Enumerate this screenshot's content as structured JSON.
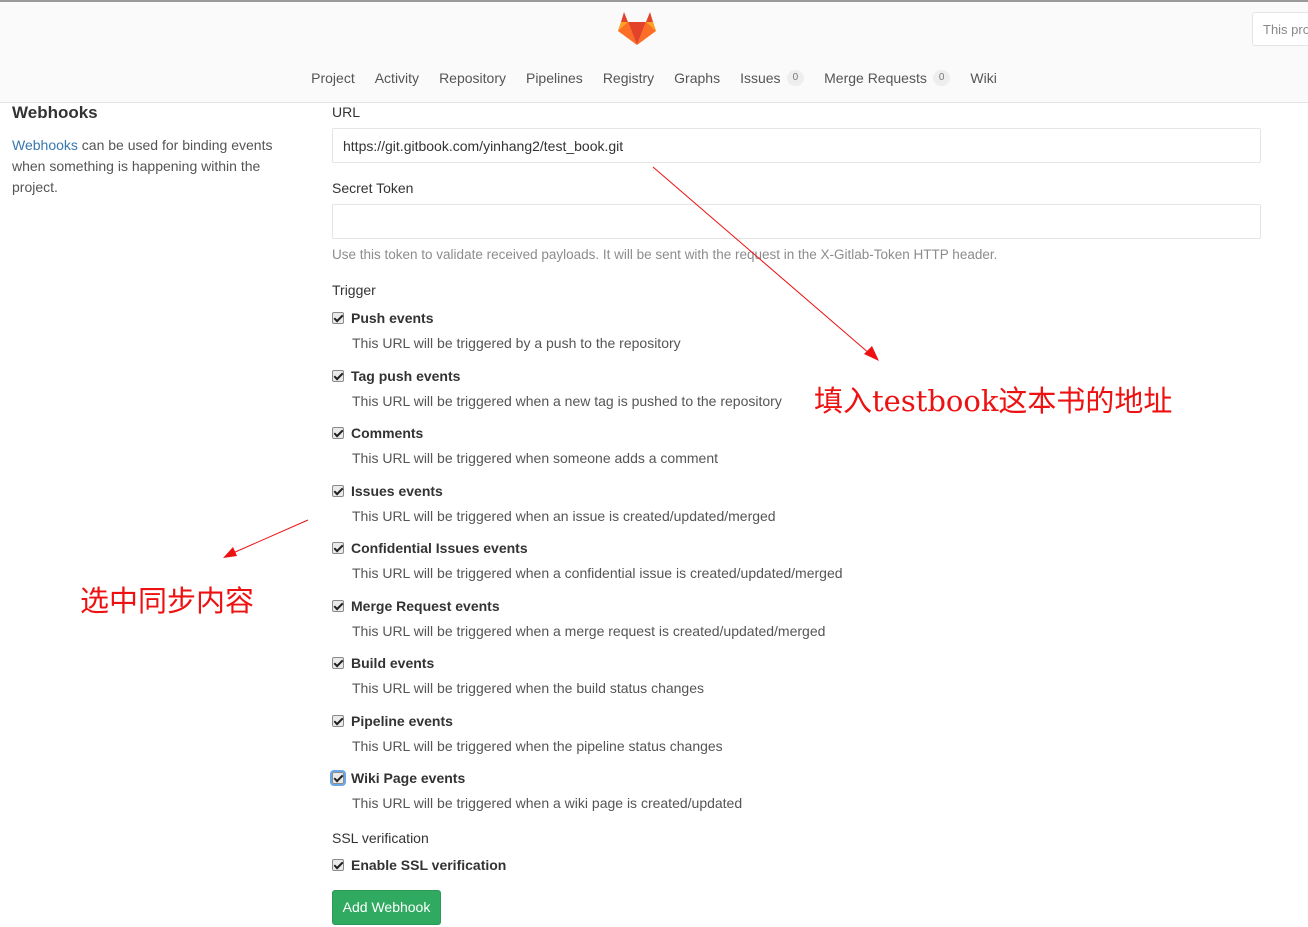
{
  "header": {
    "search_placeholder": "This project",
    "nav": [
      {
        "label": "Project"
      },
      {
        "label": "Activity"
      },
      {
        "label": "Repository"
      },
      {
        "label": "Pipelines"
      },
      {
        "label": "Registry"
      },
      {
        "label": "Graphs"
      },
      {
        "label": "Issues",
        "badge": "0"
      },
      {
        "label": "Merge Requests",
        "badge": "0"
      },
      {
        "label": "Wiki"
      }
    ]
  },
  "sidebar": {
    "title": "Webhooks",
    "link": "Webhooks",
    "description": " can be used for binding events when something is happening within the project."
  },
  "form": {
    "url_label": "URL",
    "url_value": "https://git.gitbook.com/yinhang2/test_book.git",
    "token_label": "Secret Token",
    "token_value": "",
    "token_help": "Use this token to validate received payloads. It will be sent with the request in the X-Gitlab-Token HTTP header.",
    "trigger_label": "Trigger",
    "triggers": [
      {
        "label": "Push events",
        "desc": "This URL will be triggered by a push to the repository",
        "checked": true
      },
      {
        "label": "Tag push events",
        "desc": "This URL will be triggered when a new tag is pushed to the repository",
        "checked": true
      },
      {
        "label": "Comments",
        "desc": "This URL will be triggered when someone adds a comment",
        "checked": true
      },
      {
        "label": "Issues events",
        "desc": "This URL will be triggered when an issue is created/updated/merged",
        "checked": true
      },
      {
        "label": "Confidential Issues events",
        "desc": "This URL will be triggered when a confidential issue is created/updated/merged",
        "checked": true
      },
      {
        "label": "Merge Request events",
        "desc": "This URL will be triggered when a merge request is created/updated/merged",
        "checked": true
      },
      {
        "label": "Build events",
        "desc": "This URL will be triggered when the build status changes",
        "checked": true
      },
      {
        "label": "Pipeline events",
        "desc": "This URL will be triggered when the pipeline status changes",
        "checked": true
      },
      {
        "label": "Wiki Page events",
        "desc": "This URL will be triggered when a wiki page is created/updated",
        "checked": true
      }
    ],
    "ssl_label": "SSL verification",
    "ssl_checkbox": "Enable SSL verification",
    "submit": "Add Webhook"
  },
  "annotations": {
    "url_note": "填入testbook这本书的地址",
    "trigger_note": "选中同步内容",
    "color": "#ee1111"
  },
  "colors": {
    "accent_button": "#2faa60",
    "link": "#3777b0",
    "logo": [
      "#e24329",
      "#fc6d26",
      "#fca326"
    ]
  }
}
